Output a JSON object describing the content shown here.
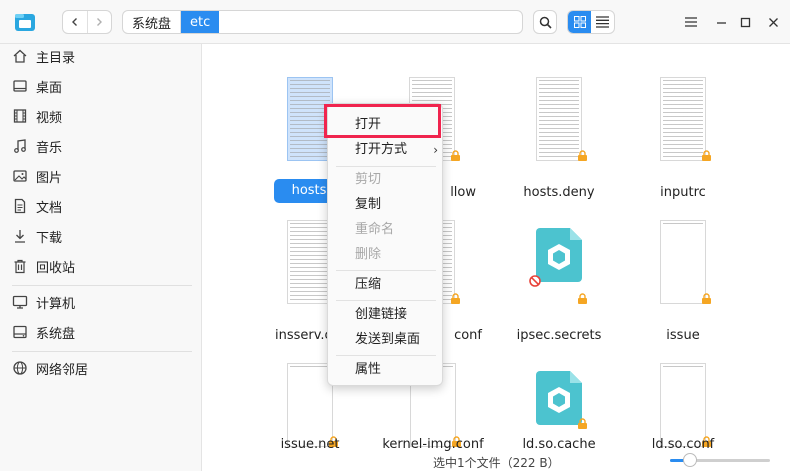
{
  "breadcrumb": [
    "系统盘",
    "etc"
  ],
  "sidebar": {
    "items": [
      {
        "label": "主目录",
        "icon": "home-icon"
      },
      {
        "label": "桌面",
        "icon": "desktop-icon"
      },
      {
        "label": "视频",
        "icon": "video-icon"
      },
      {
        "label": "音乐",
        "icon": "music-icon"
      },
      {
        "label": "图片",
        "icon": "picture-icon"
      },
      {
        "label": "文档",
        "icon": "document-icon"
      },
      {
        "label": "下载",
        "icon": "download-icon"
      },
      {
        "label": "回收站",
        "icon": "trash-icon"
      },
      {
        "label": "计算机",
        "icon": "computer-icon"
      },
      {
        "label": "系统盘",
        "icon": "disk-icon"
      },
      {
        "label": "网络邻居",
        "icon": "network-icon"
      }
    ]
  },
  "files": [
    {
      "name": "hosts",
      "selected": true
    },
    {
      "name": "llow",
      "locked": true
    },
    {
      "name": "hosts.deny",
      "locked": true
    },
    {
      "name": "inputrc",
      "locked": true
    },
    {
      "name": "insserv.co",
      "locked": false
    },
    {
      "name": "conf",
      "locked": true
    },
    {
      "name": "ipsec.secrets",
      "locked": true
    },
    {
      "name": "issue",
      "locked": true
    },
    {
      "name": "issue.net",
      "locked": true
    },
    {
      "name": "kernel-img.conf",
      "locked": true
    },
    {
      "name": "ld.so.cache",
      "locked": true
    },
    {
      "name": "ld.so.conf",
      "locked": true
    }
  ],
  "context_menu": {
    "items": [
      {
        "label": "打开",
        "disabled": false
      },
      {
        "label": "打开方式",
        "disabled": false,
        "submenu": true
      },
      {
        "label": "剪切",
        "disabled": true
      },
      {
        "label": "复制",
        "disabled": false
      },
      {
        "label": "重命名",
        "disabled": true
      },
      {
        "label": "删除",
        "disabled": true
      },
      {
        "label": "压缩",
        "disabled": false
      },
      {
        "label": "创建链接",
        "disabled": false
      },
      {
        "label": "发送到桌面",
        "disabled": false
      },
      {
        "label": "属性",
        "disabled": false
      }
    ],
    "submenu_arrow": "›"
  },
  "status": {
    "text": "选中1个文件（222 B）"
  },
  "zoom": {
    "fraction": 0.2
  },
  "colors": {
    "accent": "#2a8cf0",
    "highlight": "#f0244e",
    "lock": "#f5a623"
  }
}
